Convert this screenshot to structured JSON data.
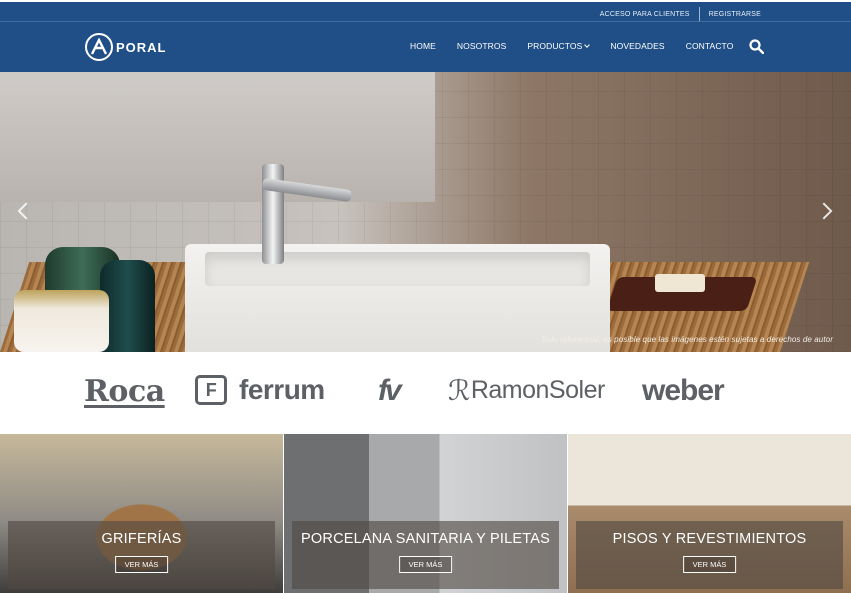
{
  "topbar": {
    "client_access": "ACCESO PARA CLIENTES",
    "register": "REGISTRARSE"
  },
  "header": {
    "logo_text": "PORAL",
    "menu": [
      {
        "label": "HOME"
      },
      {
        "label": "NOSOTROS"
      },
      {
        "label": "PRODUCTOS",
        "has_dropdown": true
      },
      {
        "label": "NOVEDADES"
      },
      {
        "label": "CONTACTO"
      }
    ],
    "search_icon": "search-icon"
  },
  "hero": {
    "disclaimer": "Solo referencial, es posible que las imágenes estén sujetas a derechos de autor",
    "prev_icon": "chevron-left-icon",
    "next_icon": "chevron-right-icon"
  },
  "brands": [
    {
      "name": "Roca"
    },
    {
      "name": "ferrum"
    },
    {
      "name": "fv"
    },
    {
      "name": "RamonSoler"
    },
    {
      "name": "weber"
    }
  ],
  "categories": [
    {
      "title": "GRIFERÍAS",
      "button": "VER MÁS"
    },
    {
      "title": "PORCELANA SANITARIA Y PILETAS",
      "button": "VER MÁS"
    },
    {
      "title": "PISOS Y REVESTIMIENTOS",
      "button": "VER MÁS"
    }
  ],
  "colors": {
    "primary": "#1f4f86",
    "brand_gray": "#5d6166"
  }
}
